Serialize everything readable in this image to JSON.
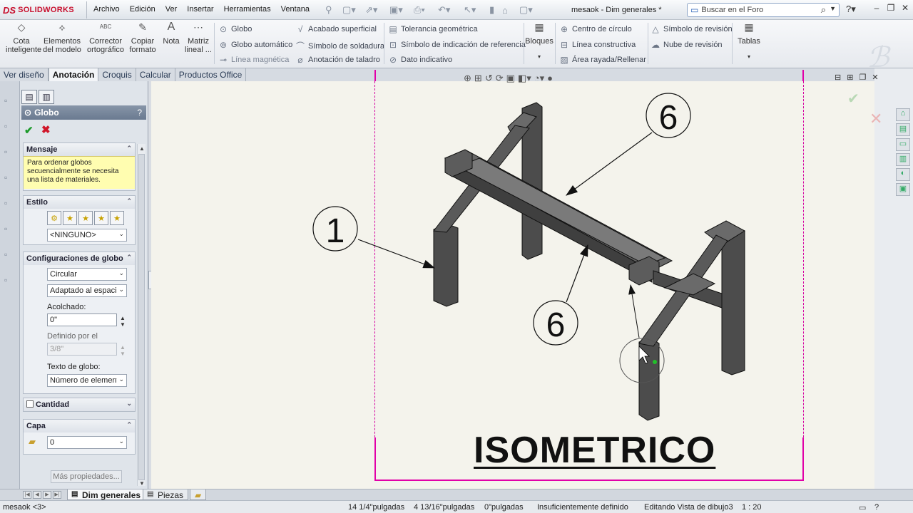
{
  "app": {
    "logo": "SOLIDWORKS",
    "logo_mark": "DS",
    "doc_title": "mesaok - Dim generales *"
  },
  "menu": [
    "Archivo",
    "Edición",
    "Ver",
    "Insertar",
    "Herramientas",
    "Ventana"
  ],
  "search": {
    "placeholder": "Buscar en el Foro"
  },
  "ribbon": {
    "big_buttons": [
      {
        "label": "Cota inteligente",
        "icon": "smart-dimension-icon"
      },
      {
        "label": "Elementos del modelo",
        "icon": "model-items-icon"
      },
      {
        "label": "Corrector ortográfico",
        "icon": "spell-check-icon"
      },
      {
        "label": "Copiar formato",
        "icon": "format-painter-icon"
      },
      {
        "label": "Nota",
        "icon": "note-icon"
      },
      {
        "label": "Matriz lineal ...",
        "icon": "linear-pattern-icon"
      }
    ],
    "col1": [
      "Globo",
      "Globo automático",
      "Línea magnética"
    ],
    "col2": [
      "Acabado superficial",
      "Símbolo de soldadura",
      "Anotación de taladro"
    ],
    "col3": [
      "Tolerancia geométrica",
      "Símbolo de indicación de referencia",
      "Dato indicativo"
    ],
    "bloques": "Bloques",
    "col4": [
      "Centro de círculo",
      "Línea constructiva",
      "Área rayada/Rellenar"
    ],
    "col5": [
      "Símbolo de revisión",
      "Nube de revisión"
    ],
    "tablas": "Tablas"
  },
  "tabs": [
    "Ver diseño",
    "Anotación",
    "Croquis",
    "Calcular",
    "Productos Office"
  ],
  "active_tab": "Anotación",
  "property_manager": {
    "title": "Globo",
    "help": "?",
    "mensaje": {
      "title": "Mensaje",
      "text": "Para ordenar globos secuencialmente se necesita una lista de materiales."
    },
    "estilo": {
      "title": "Estilo",
      "value": "<NINGUNO>"
    },
    "config": {
      "title": "Configuraciones de globo",
      "style": "Circular",
      "size": "Adaptado al espacio",
      "padding_label": "Acolchado:",
      "padding_value": "0\"",
      "defined_label": "Definido por el",
      "defined_value": "3/8\"",
      "text_label": "Texto de globo:",
      "text_value": "Número de elemento"
    },
    "cantidad": "Cantidad",
    "capa": {
      "title": "Capa",
      "value": "0"
    },
    "more": "Más propiedades..."
  },
  "drawing": {
    "title": "ISOMETRICO",
    "balloons": [
      "1",
      "6",
      "6"
    ]
  },
  "sheets": [
    "Dim generales",
    "Piezas"
  ],
  "status": {
    "doc": "mesaok <3>",
    "x": "14 1/4\"pulgadas",
    "y": "4 13/16\"pulgadas",
    "z": "0\"pulgadas",
    "state": "Insuficientemente definido",
    "edit": "Editando Vista de dibujo3",
    "scale": "1 : 20"
  }
}
